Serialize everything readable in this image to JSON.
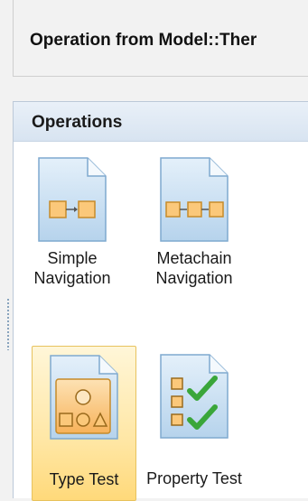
{
  "header": {
    "title": "Operation from Model::Ther"
  },
  "palette": {
    "title": "Operations",
    "items": [
      {
        "line1": "Simple",
        "line2": "Navigation",
        "icon": "simple-navigation-icon",
        "selected": false
      },
      {
        "line1": "Metachain",
        "line2": "Navigation",
        "icon": "metachain-navigation-icon",
        "selected": false
      },
      {
        "line1": "",
        "line2": "Type Test",
        "icon": "type-test-icon",
        "selected": true
      },
      {
        "line1": "",
        "line2": "Property Test",
        "icon": "property-test-icon",
        "selected": false
      }
    ]
  },
  "colors": {
    "accent_selected": "#ffe7a6",
    "check_green": "#3aa63a",
    "node_orange": "#fbc87a"
  }
}
